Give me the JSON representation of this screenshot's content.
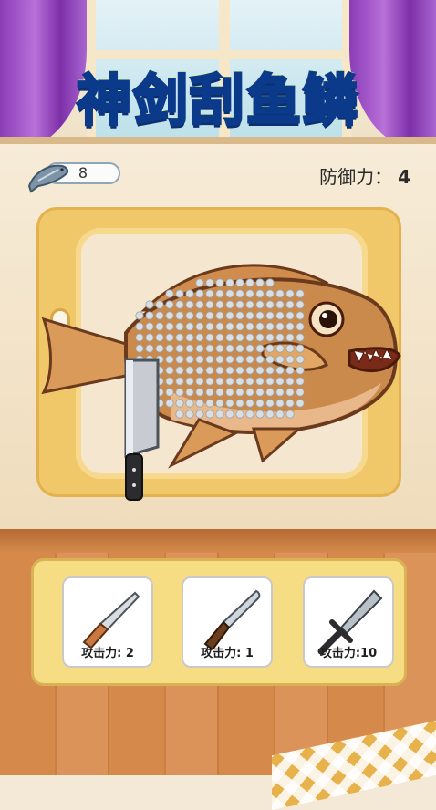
{
  "game": {
    "title": "神剑刮鱼鳞"
  },
  "status": {
    "fish_count": "8",
    "defense_label": "防御力：",
    "defense_value": "4"
  },
  "weapons": [
    {
      "name": "small-knife",
      "label": "攻击力: 2"
    },
    {
      "name": "kitchen-knife",
      "label": "攻击力: 1"
    },
    {
      "name": "sword",
      "label": "攻击力:10"
    }
  ],
  "colors": {
    "title_green": "#2fd13a",
    "title_outline": "#0c3a8a",
    "curtain_purple": "#8a3db6",
    "board_yellow": "#f0c86a",
    "panel_yellow": "#f6dc83"
  },
  "icons": [
    "fish-icon",
    "cleaver-icon",
    "knife-icon",
    "sword-icon"
  ]
}
